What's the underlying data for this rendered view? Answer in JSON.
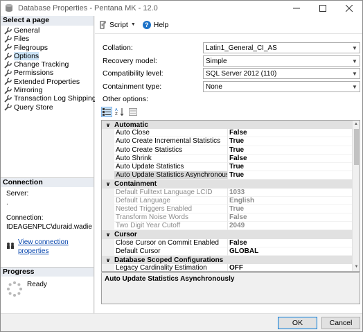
{
  "window": {
    "title": "Database Properties - Pentana MK - 12.0"
  },
  "left": {
    "select_page_header": "Select a page",
    "pages": [
      {
        "label": "General"
      },
      {
        "label": "Files"
      },
      {
        "label": "Filegroups"
      },
      {
        "label": "Options"
      },
      {
        "label": "Change Tracking"
      },
      {
        "label": "Permissions"
      },
      {
        "label": "Extended Properties"
      },
      {
        "label": "Mirroring"
      },
      {
        "label": "Transaction Log Shipping"
      },
      {
        "label": "Query Store"
      }
    ],
    "selected_page": "Options",
    "connection_header": "Connection",
    "server_label": "Server:",
    "server_value": ".",
    "connection_label": "Connection:",
    "connection_value": "IDEAGENPLC\\duraid.wadie",
    "view_conn_link": "View connection properties",
    "progress_header": "Progress",
    "progress_status": "Ready"
  },
  "toolbar": {
    "script_label": "Script",
    "help_label": "Help"
  },
  "form": {
    "collation_label": "Collation:",
    "collation_value": "Latin1_General_CI_AS",
    "recovery_label": "Recovery model:",
    "recovery_value": "Simple",
    "compat_label": "Compatibility level:",
    "compat_value": "SQL Server 2012 (110)",
    "containment_label": "Containment type:",
    "containment_value": "None",
    "other_options_label": "Other options:"
  },
  "grid": {
    "categories": [
      {
        "name": "Automatic",
        "rows": [
          {
            "name": "Auto Close",
            "value": "False"
          },
          {
            "name": "Auto Create Incremental Statistics",
            "value": "True"
          },
          {
            "name": "Auto Create Statistics",
            "value": "True"
          },
          {
            "name": "Auto Shrink",
            "value": "False"
          },
          {
            "name": "Auto Update Statistics",
            "value": "True"
          },
          {
            "name": "Auto Update Statistics Asynchronously",
            "value": "True"
          }
        ]
      },
      {
        "name": "Containment",
        "rows": [
          {
            "name": "Default Fulltext Language LCID",
            "value": "1033"
          },
          {
            "name": "Default Language",
            "value": "English"
          },
          {
            "name": "Nested Triggers Enabled",
            "value": "True"
          },
          {
            "name": "Transform Noise Words",
            "value": "False"
          },
          {
            "name": "Two Digit Year Cutoff",
            "value": "2049"
          }
        ]
      },
      {
        "name": "Cursor",
        "rows": [
          {
            "name": "Close Cursor on Commit Enabled",
            "value": "False"
          },
          {
            "name": "Default Cursor",
            "value": "GLOBAL"
          }
        ]
      },
      {
        "name": "Database Scoped Configurations",
        "rows": [
          {
            "name": "Legacy Cardinality Estimation",
            "value": "OFF"
          }
        ]
      }
    ],
    "selected_property": "Auto Update Statistics Asynchronously",
    "description": "Auto Update Statistics Asynchronously"
  },
  "buttons": {
    "ok": "OK",
    "cancel": "Cancel"
  },
  "colors": {
    "accent": "#0078d7",
    "selection": "#cce4f7",
    "link": "#0645ad"
  }
}
